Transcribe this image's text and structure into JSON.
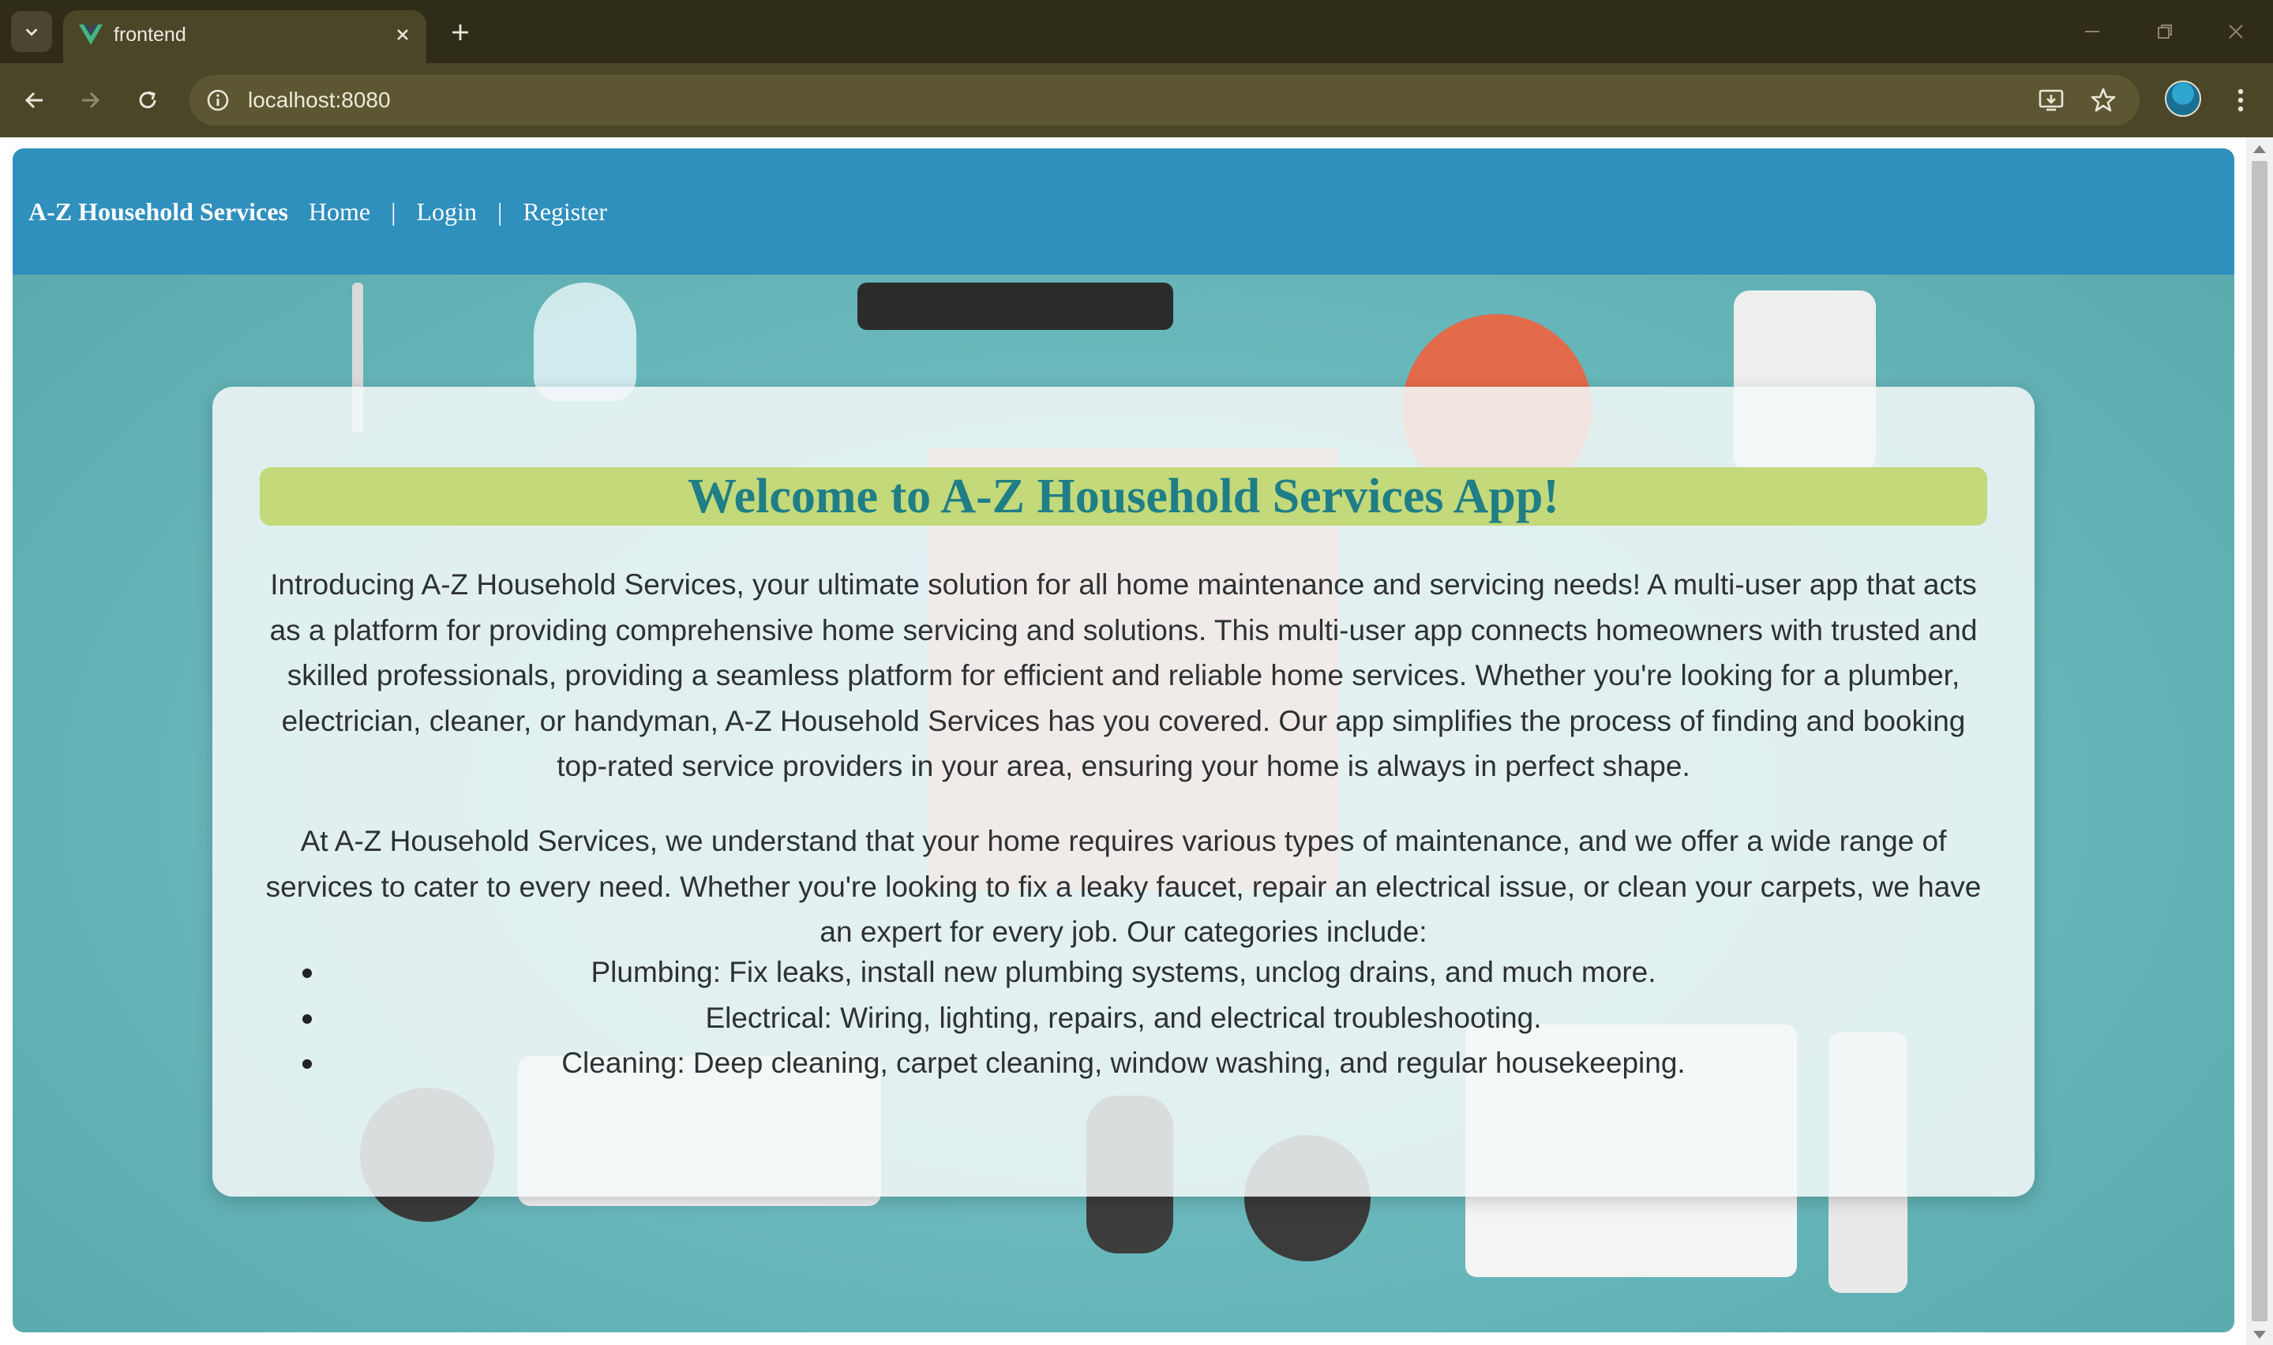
{
  "browser": {
    "tab_title": "frontend",
    "url": "localhost:8080",
    "icons": {
      "tab_search": "chevron-down-icon",
      "favicon": "vue-logo-icon",
      "tab_close": "close-icon",
      "new_tab": "plus-icon",
      "minimize": "minimize-icon",
      "restore": "restore-icon",
      "close_window": "close-icon",
      "back": "arrow-left-icon",
      "forward": "arrow-right-icon",
      "reload": "reload-icon",
      "site_info": "info-icon",
      "install": "install-icon",
      "bookmark": "star-icon",
      "profile": "avatar",
      "menu": "more-vert-icon"
    }
  },
  "navbar": {
    "brand": "A-Z Household Services",
    "links": [
      "Home",
      "Login",
      "Register"
    ],
    "separator": "|",
    "color": "#2f8fbd"
  },
  "main": {
    "heading": "Welcome to A-Z Household Services App!",
    "intro": "Introducing A-Z Household Services, your ultimate solution for all home maintenance and servicing needs! A multi-user app that acts as a platform for providing comprehensive home servicing and solutions. This multi-user app connects homeowners with trusted and skilled professionals, providing a seamless platform for efficient and reliable home services. Whether you're looking for a plumber, electrician, cleaner, or handyman, A-Z Household Services has you covered. Our app simplifies the process of finding and booking top-rated service providers in your area, ensuring your home is always in perfect shape.",
    "categories_intro": "At A-Z Household Services, we understand that your home requires various types of maintenance, and we offer a wide range of services to cater to every need. Whether you're looking to fix a leaky faucet, repair an electrical issue, or clean your carpets, we have an expert for every job. Our categories include:",
    "categories": [
      "Plumbing: Fix leaks, install new plumbing systems, unclog drains, and much more.",
      "Electrical: Wiring, lighting, repairs, and electrical troubleshooting.",
      "Cleaning: Deep cleaning, carpet cleaning, window washing, and regular housekeeping."
    ],
    "colors": {
      "heading_bg": "#c3d97a",
      "heading_text": "#1f7e86",
      "background": "#6ab9bc"
    }
  }
}
